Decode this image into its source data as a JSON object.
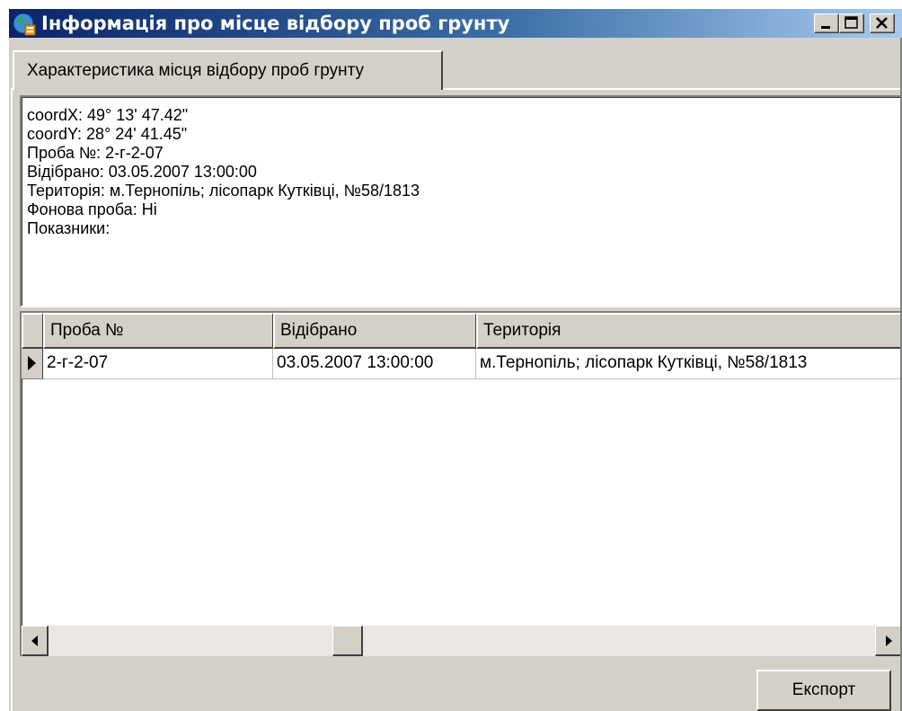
{
  "window": {
    "title": "Інформація про місце відбору проб грунту",
    "icon": "globe-app-icon",
    "controls": [
      "minimize-icon",
      "maximize-icon",
      "close-icon"
    ]
  },
  "tabs": [
    {
      "label": "Характеристика місця відбору проб грунту",
      "active": true
    }
  ],
  "info": {
    "lines": [
      "coordX: 49° 13' 47.42\"",
      "coordY: 28° 24' 41.45\"",
      "Проба №: 2-г-2-07",
      "Відібрано: 03.05.2007 13:00:00",
      "Територія: м.Тернопіль; лісопарк Кутківці, №58/1813",
      "Фонова проба: Ні",
      "Показники:"
    ]
  },
  "grid": {
    "columns": [
      "Проба №",
      "Відібрано",
      "Територія"
    ],
    "rows": [
      [
        "2-г-2-07",
        "03.05.2007 13:00:00",
        "м.Тернопіль; лісопарк Кутківці, №58/1813"
      ]
    ],
    "current_row_indicator": "row-pointer-icon"
  },
  "buttons": {
    "export_label": "Експорт"
  },
  "colors": {
    "face": "#d4d0c8",
    "title_start": "#0a246a",
    "title_end": "#a6caf0"
  }
}
